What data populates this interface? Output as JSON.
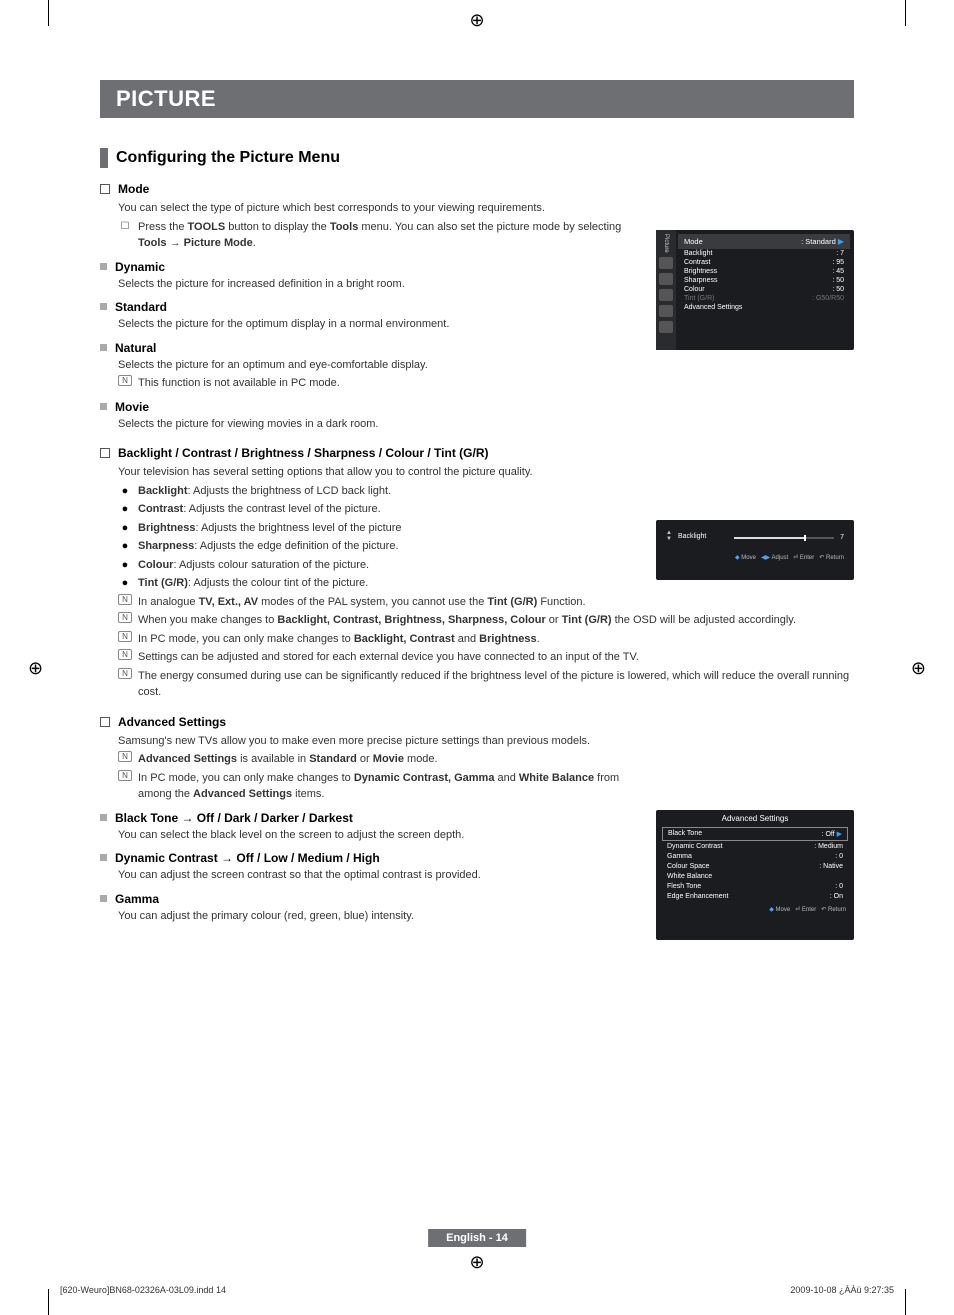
{
  "title_bar": "PICTURE",
  "section_1": "Configuring the Picture Menu",
  "mode": {
    "heading": "Mode",
    "desc": "You can select the type of picture which best corresponds to your viewing requirements.",
    "tool_pre": "Press the ",
    "tool_b1": "TOOLS",
    "tool_mid": " button to display the ",
    "tool_b2": "Tools",
    "tool_mid2": " menu. You can also set the picture mode by selecting ",
    "tool_b3": "Tools → Picture Mode",
    "tool_end": "."
  },
  "dynamic": {
    "h": "Dynamic",
    "d": "Selects the picture for increased definition in a bright room."
  },
  "standard": {
    "h": "Standard",
    "d": "Selects the picture for the optimum display in a normal environment."
  },
  "natural": {
    "h": "Natural",
    "d": "Selects the picture for an optimum and eye-comfortable display.",
    "note": "This function is not available in PC mode."
  },
  "movie": {
    "h": "Movie",
    "d": "Selects the picture for viewing movies in a dark room."
  },
  "bcbsct": {
    "h": "Backlight / Contrast / Brightness / Sharpness / Colour / Tint (G/R)",
    "intro": "Your television has several setting options that allow you to control the picture quality.",
    "items": [
      {
        "b": "Backlight",
        "t": ": Adjusts the brightness of LCD back light."
      },
      {
        "b": "Contrast",
        "t": ": Adjusts the contrast level of the picture."
      },
      {
        "b": "Brightness",
        "t": ": Adjusts the brightness level of the picture"
      },
      {
        "b": "Sharpness",
        "t": ": Adjusts the edge definition of the picture."
      },
      {
        "b": "Colour",
        "t": ": Adjusts colour saturation of the picture."
      },
      {
        "b": "Tint (G/R)",
        "t": ": Adjusts the colour tint of the picture."
      }
    ],
    "n1_pre": "In analogue ",
    "n1_b": "TV, Ext., AV",
    "n1_mid": " modes of the PAL system, you cannot use the ",
    "n1_b2": "Tint (G/R)",
    "n1_end": " Function.",
    "n2_pre": "When you make changes to ",
    "n2_b": "Backlight, Contrast, Brightness, Sharpness, Colour",
    "n2_mid": " or ",
    "n2_b2": "Tint (G/R)",
    "n2_end": " the OSD will be adjusted accordingly.",
    "n3_pre": "In PC mode, you can only make changes to ",
    "n3_b": "Backlight, Contrast",
    "n3_mid": " and ",
    "n3_b2": "Brightness",
    "n3_end": ".",
    "n4": "Settings can be adjusted and stored for each external device you have connected to an input of the TV.",
    "n5": "The energy consumed during use can be significantly reduced if the brightness level of the picture is lowered, which will reduce the overall running cost."
  },
  "adv": {
    "h": "Advanced Settings",
    "intro": "Samsung's new TVs allow you to make even more precise picture settings than previous models.",
    "n1_b": "Advanced Settings",
    "n1_mid": " is available in ",
    "n1_b2": "Standard",
    "n1_mid2": " or ",
    "n1_b3": "Movie",
    "n1_end": " mode.",
    "n2_pre": "In PC mode, you can only make changes to ",
    "n2_b": "Dynamic Contrast, Gamma",
    "n2_mid": " and ",
    "n2_b2": "White Balance",
    "n2_mid2": " from among the ",
    "n2_b3": "Advanced Settings",
    "n2_end": " items."
  },
  "blacktone": {
    "h": "Black Tone → Off / Dark / Darker / Darkest",
    "d": "You can select the black level on the screen to adjust the screen depth."
  },
  "dyncontrast": {
    "h": "Dynamic Contrast → Off / Low / Medium / High",
    "d": "You can adjust the screen contrast so that the optimal contrast is provided."
  },
  "gamma": {
    "h": "Gamma",
    "d": "You can adjust the primary colour (red, green, blue) intensity."
  },
  "osd1": {
    "side_label": "Picture",
    "hdr_l": "Mode",
    "hdr_r": ": Standard",
    "rows": [
      {
        "l": "Backlight",
        "r": ": 7"
      },
      {
        "l": "Contrast",
        "r": ": 95"
      },
      {
        "l": "Brightness",
        "r": ": 45"
      },
      {
        "l": "Sharpness",
        "r": ": 50"
      },
      {
        "l": "Colour",
        "r": ": 50"
      },
      {
        "l": "Tint (G/R)",
        "r": ": G50/R50"
      },
      {
        "l": "Advanced Settings",
        "r": ""
      }
    ]
  },
  "osd2": {
    "label": "Backlight",
    "value": "7",
    "foot": "Move    Adjust    Enter    Return",
    "foot_move": "Move",
    "foot_adjust": "Adjust",
    "foot_enter": "Enter",
    "foot_return": "Return"
  },
  "osd3": {
    "title": "Advanced Settings",
    "rows": [
      {
        "l": "Black Tone",
        "r": ": Off"
      },
      {
        "l": "Dynamic Contrast",
        "r": ": Medium"
      },
      {
        "l": "Gamma",
        "r": ": 0"
      },
      {
        "l": "Colour Space",
        "r": ": Native"
      },
      {
        "l": "White Balance",
        "r": ""
      },
      {
        "l": "Flesh Tone",
        "r": ": 0"
      },
      {
        "l": "Edge Enhancement",
        "r": ": On"
      }
    ],
    "foot_move": "Move",
    "foot_enter": "Enter",
    "foot_return": "Return"
  },
  "page_foot": "English - 14",
  "doc_foot_l": "[620-Weuro]BN68-02326A-03L09.indd   14",
  "doc_foot_r": "2009-10-08   ¿ÀÀü 9:27:35"
}
